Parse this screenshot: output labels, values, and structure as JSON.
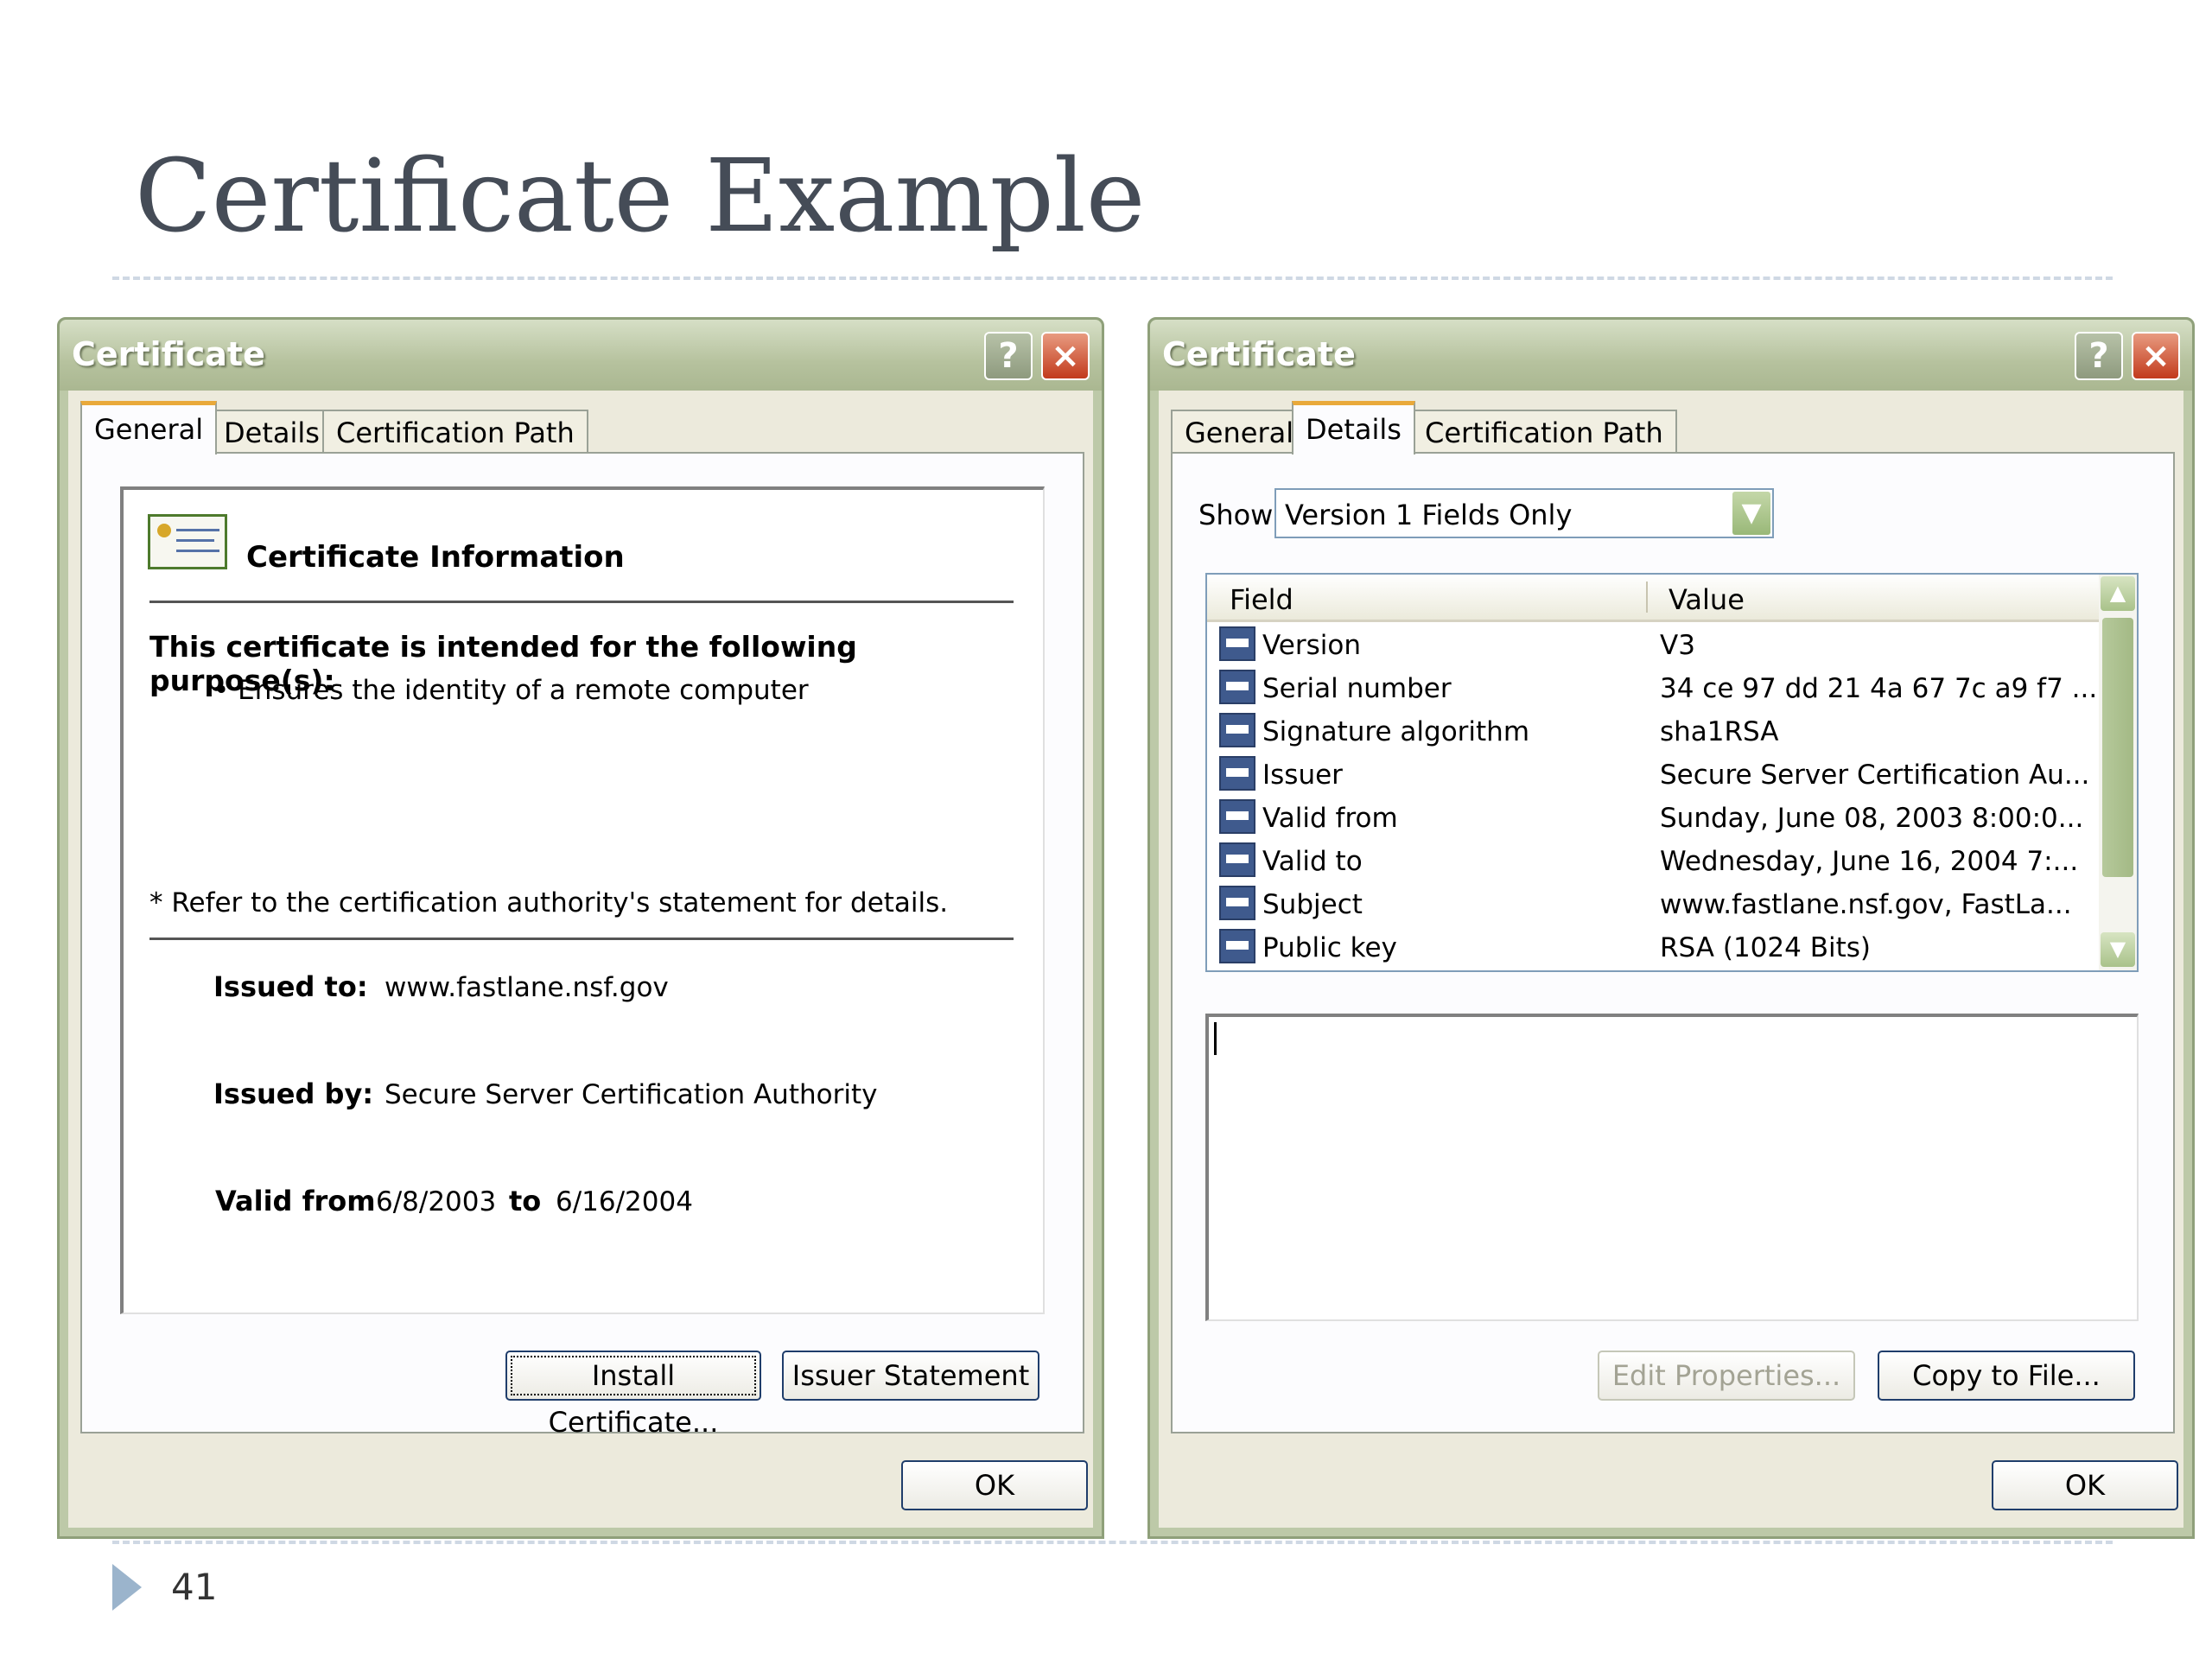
{
  "slide": {
    "title": "Certificate Example",
    "page_number": "41"
  },
  "left_window": {
    "title": "Certificate",
    "help_label": "?",
    "close_label": "×",
    "tabs": [
      {
        "label": "General",
        "active": true
      },
      {
        "label": "Details",
        "active": false
      },
      {
        "label": "Certification Path",
        "active": false
      }
    ],
    "info_heading": "Certificate Information",
    "purpose_title": "This certificate is intended for the following purpose(s):",
    "purpose_item": "• Ensures the identity of a remote computer",
    "refer_note": "* Refer to the certification authority's statement for details.",
    "issued_to_label": "Issued to:",
    "issued_to_value": "www.fastlane.nsf.gov",
    "issued_by_label": "Issued by:",
    "issued_by_value": "Secure Server Certification Authority",
    "valid_from_label": "Valid from",
    "valid_from_value": "6/8/2003",
    "valid_to_label": "to",
    "valid_to_value": "6/16/2004",
    "install_button": "Install Certificate...",
    "issuer_button": "Issuer Statement",
    "ok_button": "OK"
  },
  "right_window": {
    "title": "Certificate",
    "help_label": "?",
    "close_label": "×",
    "tabs": [
      {
        "label": "General",
        "active": false
      },
      {
        "label": "Details",
        "active": true
      },
      {
        "label": "Certification Path",
        "active": false
      }
    ],
    "show_label": "Show:",
    "show_value": "Version 1 Fields Only",
    "columns": {
      "field": "Field",
      "value": "Value"
    },
    "rows": [
      {
        "field": "Version",
        "value": "V3"
      },
      {
        "field": "Serial number",
        "value": "34 ce 97 dd 21 4a 67 7c a9 f7 ..."
      },
      {
        "field": "Signature algorithm",
        "value": "sha1RSA"
      },
      {
        "field": "Issuer",
        "value": "Secure Server Certification Au..."
      },
      {
        "field": "Valid from",
        "value": "Sunday, June 08, 2003 8:00:0..."
      },
      {
        "field": "Valid to",
        "value": "Wednesday, June 16, 2004 7:..."
      },
      {
        "field": "Subject",
        "value": "www.fastlane.nsf.gov, FastLa..."
      },
      {
        "field": "Public key",
        "value": "RSA (1024 Bits)"
      }
    ],
    "edit_button": "Edit Properties...",
    "copy_button": "Copy to File...",
    "ok_button": "OK"
  }
}
